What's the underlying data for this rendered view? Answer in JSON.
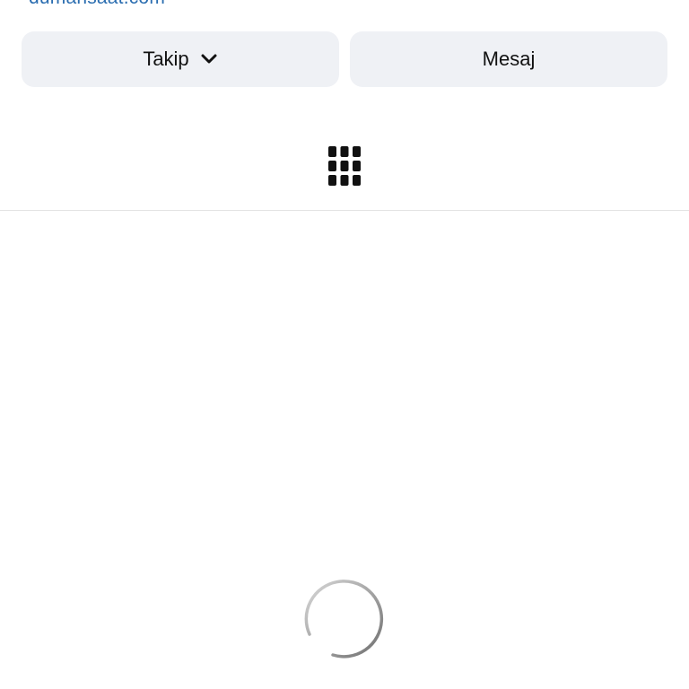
{
  "profile": {
    "link_text": "dumansaat.com"
  },
  "actions": {
    "follow_label": "Takip",
    "message_label": "Mesaj"
  },
  "icons": {
    "follow_dropdown": "chevron-down-icon",
    "posts_tab": "grid-icon",
    "loading": "spinner-icon"
  },
  "colors": {
    "link": "#2a6db0",
    "button_bg": "#eff1f5",
    "text": "#111111",
    "divider": "#e3e3e3"
  }
}
